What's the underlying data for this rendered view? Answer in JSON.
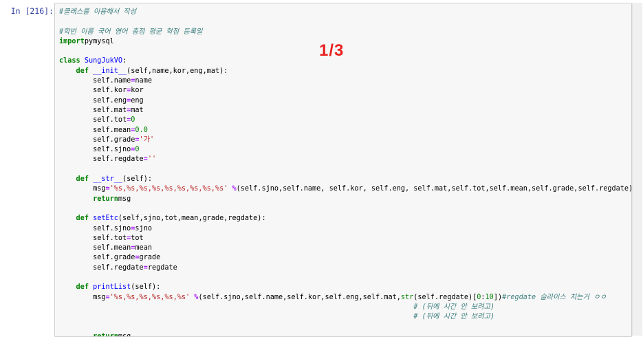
{
  "cell": {
    "prompt": "In [216]:",
    "page_label": "1/3",
    "lines": [
      [
        [
          "cm",
          "#클래스를 이용해서 작성"
        ]
      ],
      [],
      [
        [
          "cm",
          "#학번 이름 국어 영어 총점 평균 학점 등록일"
        ]
      ],
      [
        [
          "kw",
          "import"
        ],
        [
          "",
          "pymysql"
        ]
      ],
      [],
      [
        [
          "kw",
          "class"
        ],
        [
          "",
          ""
        ],
        [
          "fn",
          "SungJukVO"
        ],
        [
          "",
          ":"
        ]
      ],
      [
        [
          "",
          "    "
        ],
        [
          "kw",
          "def"
        ],
        [
          "",
          ""
        ],
        [
          "fn",
          "__init__"
        ],
        [
          "",
          "(self,name,kor,eng,mat):"
        ]
      ],
      [
        [
          "",
          "        self.name"
        ],
        [
          "op",
          "="
        ],
        [
          "",
          "name"
        ]
      ],
      [
        [
          "",
          "        self.kor"
        ],
        [
          "op",
          "="
        ],
        [
          "",
          "kor"
        ]
      ],
      [
        [
          "",
          "        self.eng"
        ],
        [
          "op",
          "="
        ],
        [
          "",
          "eng"
        ]
      ],
      [
        [
          "",
          "        self.mat"
        ],
        [
          "op",
          "="
        ],
        [
          "",
          "mat"
        ]
      ],
      [
        [
          "",
          "        self.tot"
        ],
        [
          "op",
          "="
        ],
        [
          "nm",
          "0"
        ]
      ],
      [
        [
          "",
          "        self.mean"
        ],
        [
          "op",
          "="
        ],
        [
          "nm",
          "0.0"
        ]
      ],
      [
        [
          "",
          "        self.grade"
        ],
        [
          "op",
          "="
        ],
        [
          "st",
          "'가'"
        ]
      ],
      [
        [
          "",
          "        self.sjno"
        ],
        [
          "op",
          "="
        ],
        [
          "nm",
          "0"
        ]
      ],
      [
        [
          "",
          "        self.regdate"
        ],
        [
          "op",
          "="
        ],
        [
          "st",
          "''"
        ]
      ],
      [],
      [
        [
          "",
          "    "
        ],
        [
          "kw",
          "def"
        ],
        [
          "",
          ""
        ],
        [
          "fn",
          "__str__"
        ],
        [
          "",
          "(self):"
        ]
      ],
      [
        [
          "",
          "        msg"
        ],
        [
          "op",
          "="
        ],
        [
          "st",
          "'%s,%s,%s,%s,%s,%s,%s,%s,%s'"
        ],
        [
          "",
          ""
        ],
        [
          "op",
          "%"
        ],
        [
          "",
          "(self.sjno,self.name, self.kor, self.eng, self.mat,self.tot,self.mean,self.grade,self.regdate)"
        ]
      ],
      [
        [
          "",
          "        "
        ],
        [
          "kw",
          "return"
        ],
        [
          "",
          "msg"
        ]
      ],
      [],
      [
        [
          "",
          "    "
        ],
        [
          "kw",
          "def"
        ],
        [
          "",
          ""
        ],
        [
          "fn",
          "setEtc"
        ],
        [
          "",
          "(self,sjno,tot,mean,grade,regdate):"
        ]
      ],
      [
        [
          "",
          "        self.sjno"
        ],
        [
          "op",
          "="
        ],
        [
          "",
          "sjno"
        ]
      ],
      [
        [
          "",
          "        self.tot"
        ],
        [
          "op",
          "="
        ],
        [
          "",
          "tot"
        ]
      ],
      [
        [
          "",
          "        self.mean"
        ],
        [
          "op",
          "="
        ],
        [
          "",
          "mean"
        ]
      ],
      [
        [
          "",
          "        self.grade"
        ],
        [
          "op",
          "="
        ],
        [
          "",
          "grade"
        ]
      ],
      [
        [
          "",
          "        self.regdate"
        ],
        [
          "op",
          "="
        ],
        [
          "",
          "regdate"
        ]
      ],
      [],
      [
        [
          "",
          "    "
        ],
        [
          "kw",
          "def"
        ],
        [
          "",
          ""
        ],
        [
          "fn",
          "printList"
        ],
        [
          "",
          "(self):"
        ]
      ],
      [
        [
          "",
          "        msg"
        ],
        [
          "op",
          "="
        ],
        [
          "st",
          "'%s,%s,%s,%s,%s,%s'"
        ],
        [
          "",
          ""
        ],
        [
          "op",
          "%"
        ],
        [
          "",
          "(self.sjno,self.name,self.kor,self.eng,self.mat,"
        ],
        [
          "bi",
          "str"
        ],
        [
          "",
          "(self.regdate)["
        ],
        [
          "nm",
          "0"
        ],
        [
          "",
          ":"
        ],
        [
          "nm",
          "10"
        ],
        [
          "",
          "])"
        ],
        [
          "cm",
          "#regdate 슬라이스 치는거 ㅇㅇ"
        ]
      ],
      [
        [
          "",
          "                                                                                    "
        ],
        [
          "cm",
          "# (뒤에 시간 안 보려고)"
        ]
      ],
      [
        [
          "",
          "                                                                                    "
        ],
        [
          "cm",
          "# (뒤에 시간 안 보려고)"
        ]
      ],
      [],
      [
        [
          "",
          "        "
        ],
        [
          "kw",
          "return"
        ],
        [
          "",
          "msg"
        ]
      ]
    ]
  }
}
